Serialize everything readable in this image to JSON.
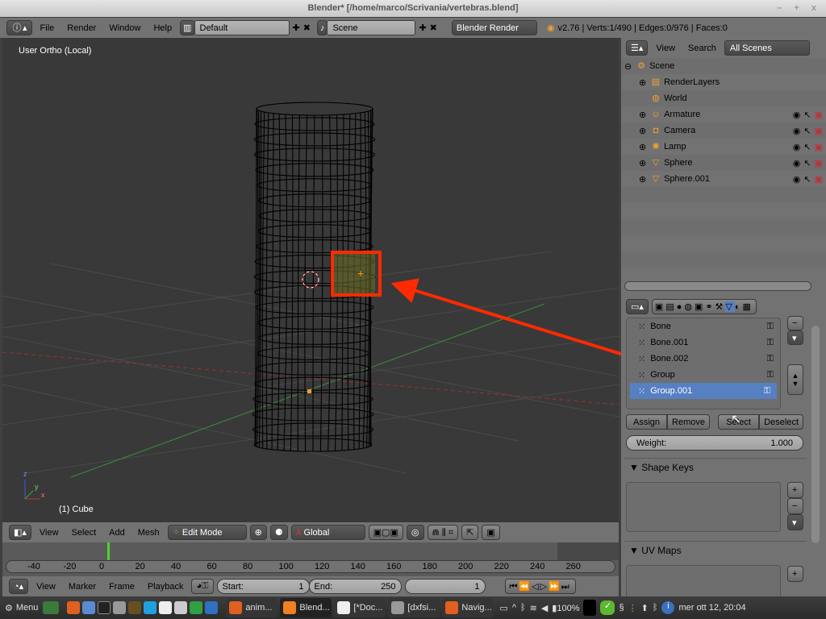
{
  "window": {
    "title": "Blender* [/home/marco/Scrivania/vertebras.blend]",
    "controls": "– + x"
  },
  "info_header": {
    "menus": [
      "File",
      "Render",
      "Window",
      "Help"
    ],
    "layout": "Default",
    "scene": "Scene",
    "engine": "Blender Render",
    "stats": "v2.76 | Verts:1/490 | Edges:0/976 | Faces:0"
  },
  "viewport": {
    "view_label": "User Ortho (Local)",
    "object_label": "(1) Cube",
    "axis_z": "z",
    "axis_x": "x",
    "axis_y": "y"
  },
  "view3d_header": {
    "menus": [
      "View",
      "Select",
      "Add",
      "Mesh"
    ],
    "mode": "Edit Mode",
    "orientation": "Global"
  },
  "timeline": {
    "ticks": [
      "-40",
      "-20",
      "0",
      "20",
      "40",
      "60",
      "80",
      "100",
      "120",
      "140",
      "160",
      "180",
      "200",
      "220",
      "240",
      "260"
    ],
    "current_frame_value": 0,
    "menus": [
      "View",
      "Marker",
      "Frame",
      "Playback"
    ],
    "start_label": "Start:",
    "start": "1",
    "end_label": "End:",
    "end": "250",
    "frame": "1"
  },
  "outliner": {
    "menus": [
      "View",
      "Search"
    ],
    "filter": "All Scenes",
    "items": [
      {
        "name": "Scene",
        "icon": "scene-icon"
      },
      {
        "name": "RenderLayers",
        "icon": "renderlayers-icon"
      },
      {
        "name": "World",
        "icon": "world-icon"
      },
      {
        "name": "Armature",
        "icon": "armature-icon"
      },
      {
        "name": "Camera",
        "icon": "camera-icon"
      },
      {
        "name": "Lamp",
        "icon": "lamp-icon"
      },
      {
        "name": "Sphere",
        "icon": "mesh-icon"
      },
      {
        "name": "Sphere.001",
        "icon": "mesh-icon"
      }
    ]
  },
  "properties": {
    "vertex_groups": [
      "Bone",
      "Bone.001",
      "Bone.002",
      "Group",
      "Group.001"
    ],
    "selected_group": "Group.001",
    "buttons": {
      "assign": "Assign",
      "remove": "Remove",
      "select": "Select",
      "deselect": "Deselect"
    },
    "weight_label": "Weight:",
    "weight": "1.000",
    "panels": [
      "Shape Keys",
      "UV Maps"
    ]
  },
  "taskbar": {
    "menu": "Menu",
    "tasks": [
      "anim...",
      "Blend...",
      "[*Doc...",
      "[dxfsi...",
      "Navig..."
    ],
    "active_task": "Blend...",
    "battery": "100%",
    "clock": "mer ott 12, 20:04"
  },
  "colors": {
    "highlight": "#5680c2",
    "annotation": "#ff2a00",
    "viewport_bg": "#393939"
  }
}
